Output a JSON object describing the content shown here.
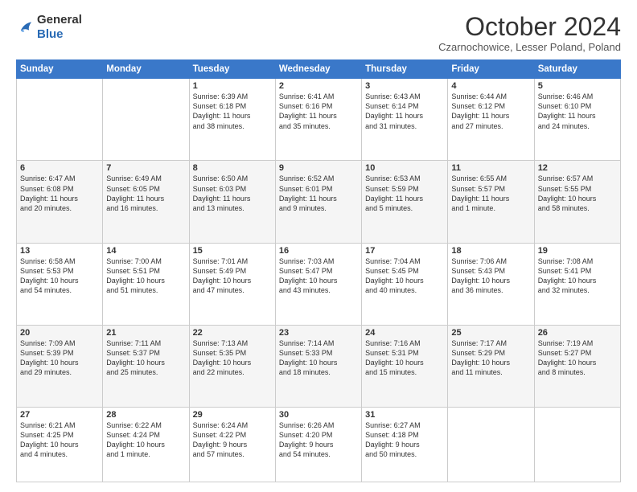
{
  "logo": {
    "general": "General",
    "blue": "Blue"
  },
  "title": "October 2024",
  "location": "Czarnochowice, Lesser Poland, Poland",
  "headers": [
    "Sunday",
    "Monday",
    "Tuesday",
    "Wednesday",
    "Thursday",
    "Friday",
    "Saturday"
  ],
  "weeks": [
    [
      {
        "day": "",
        "lines": []
      },
      {
        "day": "",
        "lines": []
      },
      {
        "day": "1",
        "lines": [
          "Sunrise: 6:39 AM",
          "Sunset: 6:18 PM",
          "Daylight: 11 hours",
          "and 38 minutes."
        ]
      },
      {
        "day": "2",
        "lines": [
          "Sunrise: 6:41 AM",
          "Sunset: 6:16 PM",
          "Daylight: 11 hours",
          "and 35 minutes."
        ]
      },
      {
        "day": "3",
        "lines": [
          "Sunrise: 6:43 AM",
          "Sunset: 6:14 PM",
          "Daylight: 11 hours",
          "and 31 minutes."
        ]
      },
      {
        "day": "4",
        "lines": [
          "Sunrise: 6:44 AM",
          "Sunset: 6:12 PM",
          "Daylight: 11 hours",
          "and 27 minutes."
        ]
      },
      {
        "day": "5",
        "lines": [
          "Sunrise: 6:46 AM",
          "Sunset: 6:10 PM",
          "Daylight: 11 hours",
          "and 24 minutes."
        ]
      }
    ],
    [
      {
        "day": "6",
        "lines": [
          "Sunrise: 6:47 AM",
          "Sunset: 6:08 PM",
          "Daylight: 11 hours",
          "and 20 minutes."
        ]
      },
      {
        "day": "7",
        "lines": [
          "Sunrise: 6:49 AM",
          "Sunset: 6:05 PM",
          "Daylight: 11 hours",
          "and 16 minutes."
        ]
      },
      {
        "day": "8",
        "lines": [
          "Sunrise: 6:50 AM",
          "Sunset: 6:03 PM",
          "Daylight: 11 hours",
          "and 13 minutes."
        ]
      },
      {
        "day": "9",
        "lines": [
          "Sunrise: 6:52 AM",
          "Sunset: 6:01 PM",
          "Daylight: 11 hours",
          "and 9 minutes."
        ]
      },
      {
        "day": "10",
        "lines": [
          "Sunrise: 6:53 AM",
          "Sunset: 5:59 PM",
          "Daylight: 11 hours",
          "and 5 minutes."
        ]
      },
      {
        "day": "11",
        "lines": [
          "Sunrise: 6:55 AM",
          "Sunset: 5:57 PM",
          "Daylight: 11 hours",
          "and 1 minute."
        ]
      },
      {
        "day": "12",
        "lines": [
          "Sunrise: 6:57 AM",
          "Sunset: 5:55 PM",
          "Daylight: 10 hours",
          "and 58 minutes."
        ]
      }
    ],
    [
      {
        "day": "13",
        "lines": [
          "Sunrise: 6:58 AM",
          "Sunset: 5:53 PM",
          "Daylight: 10 hours",
          "and 54 minutes."
        ]
      },
      {
        "day": "14",
        "lines": [
          "Sunrise: 7:00 AM",
          "Sunset: 5:51 PM",
          "Daylight: 10 hours",
          "and 51 minutes."
        ]
      },
      {
        "day": "15",
        "lines": [
          "Sunrise: 7:01 AM",
          "Sunset: 5:49 PM",
          "Daylight: 10 hours",
          "and 47 minutes."
        ]
      },
      {
        "day": "16",
        "lines": [
          "Sunrise: 7:03 AM",
          "Sunset: 5:47 PM",
          "Daylight: 10 hours",
          "and 43 minutes."
        ]
      },
      {
        "day": "17",
        "lines": [
          "Sunrise: 7:04 AM",
          "Sunset: 5:45 PM",
          "Daylight: 10 hours",
          "and 40 minutes."
        ]
      },
      {
        "day": "18",
        "lines": [
          "Sunrise: 7:06 AM",
          "Sunset: 5:43 PM",
          "Daylight: 10 hours",
          "and 36 minutes."
        ]
      },
      {
        "day": "19",
        "lines": [
          "Sunrise: 7:08 AM",
          "Sunset: 5:41 PM",
          "Daylight: 10 hours",
          "and 32 minutes."
        ]
      }
    ],
    [
      {
        "day": "20",
        "lines": [
          "Sunrise: 7:09 AM",
          "Sunset: 5:39 PM",
          "Daylight: 10 hours",
          "and 29 minutes."
        ]
      },
      {
        "day": "21",
        "lines": [
          "Sunrise: 7:11 AM",
          "Sunset: 5:37 PM",
          "Daylight: 10 hours",
          "and 25 minutes."
        ]
      },
      {
        "day": "22",
        "lines": [
          "Sunrise: 7:13 AM",
          "Sunset: 5:35 PM",
          "Daylight: 10 hours",
          "and 22 minutes."
        ]
      },
      {
        "day": "23",
        "lines": [
          "Sunrise: 7:14 AM",
          "Sunset: 5:33 PM",
          "Daylight: 10 hours",
          "and 18 minutes."
        ]
      },
      {
        "day": "24",
        "lines": [
          "Sunrise: 7:16 AM",
          "Sunset: 5:31 PM",
          "Daylight: 10 hours",
          "and 15 minutes."
        ]
      },
      {
        "day": "25",
        "lines": [
          "Sunrise: 7:17 AM",
          "Sunset: 5:29 PM",
          "Daylight: 10 hours",
          "and 11 minutes."
        ]
      },
      {
        "day": "26",
        "lines": [
          "Sunrise: 7:19 AM",
          "Sunset: 5:27 PM",
          "Daylight: 10 hours",
          "and 8 minutes."
        ]
      }
    ],
    [
      {
        "day": "27",
        "lines": [
          "Sunrise: 6:21 AM",
          "Sunset: 4:25 PM",
          "Daylight: 10 hours",
          "and 4 minutes."
        ]
      },
      {
        "day": "28",
        "lines": [
          "Sunrise: 6:22 AM",
          "Sunset: 4:24 PM",
          "Daylight: 10 hours",
          "and 1 minute."
        ]
      },
      {
        "day": "29",
        "lines": [
          "Sunrise: 6:24 AM",
          "Sunset: 4:22 PM",
          "Daylight: 9 hours",
          "and 57 minutes."
        ]
      },
      {
        "day": "30",
        "lines": [
          "Sunrise: 6:26 AM",
          "Sunset: 4:20 PM",
          "Daylight: 9 hours",
          "and 54 minutes."
        ]
      },
      {
        "day": "31",
        "lines": [
          "Sunrise: 6:27 AM",
          "Sunset: 4:18 PM",
          "Daylight: 9 hours",
          "and 50 minutes."
        ]
      },
      {
        "day": "",
        "lines": []
      },
      {
        "day": "",
        "lines": []
      }
    ]
  ]
}
